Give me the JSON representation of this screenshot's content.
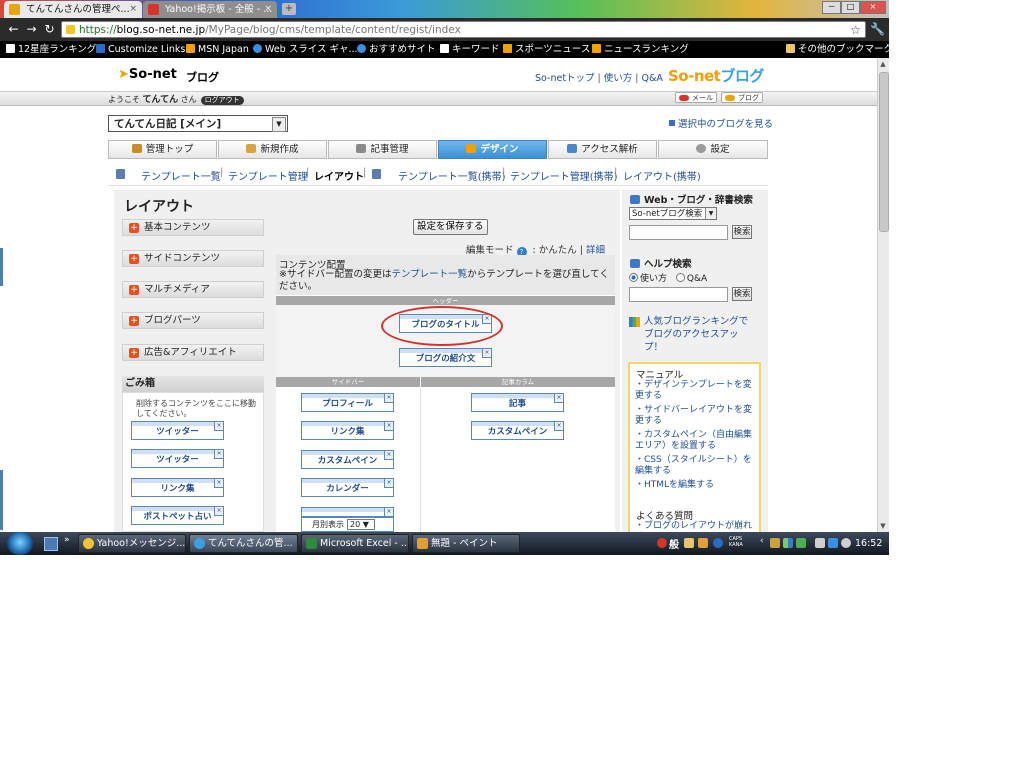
{
  "browser": {
    "tabs": [
      {
        "title": "てんてんさんの管理ペ...",
        "active": true,
        "icon_color": "#e6a800"
      },
      {
        "title": "Yahoo!掲示板 - 全般 - ...",
        "active": false,
        "icon_color": "#d8342c"
      }
    ],
    "new_tab_icon": "plus-icon",
    "window_buttons": [
      "－",
      "□",
      "×"
    ],
    "url": {
      "scheme": "https://",
      "host": "blog.so-net.ne.jp",
      "path": "/MyPage/blog/cms/template/content/regist/index"
    },
    "nav_icons": [
      "back-arrow-icon",
      "forward-arrow-icon",
      "reload-icon"
    ],
    "bookmarks": [
      {
        "label": "12星座ランキング",
        "icon": "page-icon"
      },
      {
        "label": "Customize Links",
        "icon": "msn-icon"
      },
      {
        "label": "MSN Japan",
        "icon": "msn-butterfly-icon"
      },
      {
        "label": "Web スライス ギャ...",
        "icon": "ie-icon"
      },
      {
        "label": "おすすめサイト",
        "icon": "ie-icon"
      },
      {
        "label": "キーワード",
        "icon": "page-icon"
      },
      {
        "label": "スポーツニュース",
        "icon": "msn-butterfly-icon"
      },
      {
        "label": "ニュースランキング",
        "icon": "msn-butterfly-icon"
      }
    ],
    "other_bookmarks": "その他のブックマーク"
  },
  "site": {
    "logo": "So-net",
    "logo_suffix": "ブログ",
    "top_links": [
      "So-netトップ",
      "使い方",
      "Q&A"
    ],
    "brand_logo_a": "So-net",
    "brand_logo_b": "ブログ",
    "welcome_prefix": "ようこそ",
    "welcome_user": "てんてん",
    "welcome_suffix": "さん",
    "logout": "ログアウト",
    "mail_btn": "メール",
    "blog_btn": "ブログ",
    "blog_select": "てんてん日記 [メイン]",
    "view_blog": "選択中のブログを見る",
    "main_tabs": [
      {
        "label": "管理トップ",
        "icon_color": "#c98b2c"
      },
      {
        "label": "新規作成",
        "icon_color": "#d9a43a"
      },
      {
        "label": "記事管理",
        "icon_color": "#8a8a8a"
      },
      {
        "label": "デザイン",
        "icon_color": "#f0a000",
        "active": true
      },
      {
        "label": "アクセス解析",
        "icon_color": "#4a86c8"
      },
      {
        "label": "設定",
        "icon_color": "#9a9a9a"
      }
    ],
    "sub_nav": [
      "テンプレート一覧",
      "テンプレート管理",
      "レイアウト",
      "テンプレート一覧(携帯)",
      "テンプレート管理(携帯)",
      "レイアウト(携帯)"
    ]
  },
  "layout": {
    "title": "レイアウト",
    "categories": [
      "基本コンテンツ",
      "サイドコンテンツ",
      "マルチメディア",
      "ブログパーツ",
      "広告&アフィリエイト"
    ],
    "trash_title": "ごみ箱",
    "trash_note": "削除するコンテンツをここに移動してください。",
    "trash_items": [
      "ツイッター",
      "ツイッター",
      "リンク集",
      "ポストペット占い"
    ],
    "save_button": "設定を保存する",
    "edit_mode_label": "編集モード",
    "edit_mode_simple": "かんたん",
    "edit_mode_detail": "詳細",
    "content_title": "コンテンツ配置",
    "content_note_a": "※サイドバー配置の変更は",
    "content_note_link": "テンプレート一覧",
    "content_note_b": "からテンプレートを選び直してください。",
    "header_band": "ヘッダー",
    "header_items": [
      "ブログのタイトル",
      "ブログの紹介文"
    ],
    "sidebar_band": "サイドバー",
    "article_band": "記事カラム",
    "sidebar_items": [
      "プロフィール",
      "リンク集",
      "カスタムペイン",
      "カレンダー"
    ],
    "article_items": [
      "記事",
      "カスタムペイン"
    ],
    "monthly_label": "月別表示",
    "monthly_value": "20",
    "close_glyph": "×"
  },
  "right_sidebar": {
    "search_title": "Web・ブログ・辞書検索",
    "search_select": "So-netブログ検索",
    "search_btn": "検索",
    "help_title": "ヘルプ検索",
    "help_radio_a": "使い方",
    "help_radio_b": "Q&A",
    "help_btn": "検索",
    "rank_link": "人気ブログランキングでブログのアクセスアップ！",
    "manual_title": "マニュアル",
    "manual_links": [
      "・デザインテンプレートを変更する",
      "・サイドバーレイアウトを変更する",
      "・カスタムペイン（自由編集エリア）を設置する",
      "・CSS（スタイルシート）を編集する",
      "・HTMLを編集する"
    ],
    "faq_title": "よくある質問",
    "faq_link": "・ブログのレイアウトが崩れる"
  },
  "taskbar": {
    "tasks": [
      {
        "label": "Yahoo!メッセンジ...",
        "icon_color": "#f4c430"
      },
      {
        "label": "てんてんさんの管...",
        "icon_color": "#3aa0e0"
      },
      {
        "label": "Microsoft Excel - ...",
        "icon_color": "#2e8b3a"
      },
      {
        "label": "無題 - ペイント",
        "icon_color": "#e0a030"
      }
    ],
    "ime_label": "般",
    "caps_label": "CAPS KANA",
    "clock": "16:52"
  }
}
